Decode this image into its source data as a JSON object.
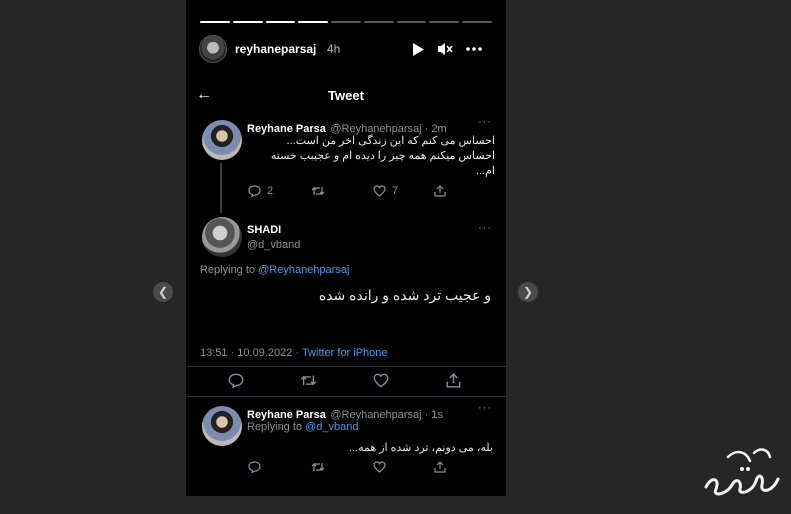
{
  "story": {
    "username": "reyhaneparsaj",
    "time": "4h",
    "progress_segments_total": 9,
    "progress_segments_done": 4
  },
  "tweet_header": {
    "title": "Tweet"
  },
  "tweets": [
    {
      "name": "Reyhane Parsa",
      "handle": "@Reyhanehparsaj · 2m",
      "lines": [
        "احساس می کنم که این زندگی اخر من است...",
        "احساس میکنم همه چیز را دیده ام و عجیبب خسته",
        "ام..."
      ],
      "replies": "2",
      "likes": "7"
    },
    {
      "name": "SHADI",
      "handle": "@d_vband",
      "replying_prefix": "Replying to",
      "replying_to": "@Reyhanehparsaj",
      "text": "و عجیب ترد شده و رانده شده",
      "timestamp": "13:51 · 10.09.2022 ·",
      "source": "Twitter for iPhone"
    },
    {
      "name": "Reyhane Parsa",
      "handle": "@Reyhanehparsaj · 1s",
      "replying_prefix": "Replying to",
      "replying_to": "@d_vband",
      "text": "بله، می دونم، ترد شده از همه..."
    }
  ],
  "icons": {
    "play": "play-icon",
    "mute": "mute-icon",
    "more": "more-icon",
    "back": "back-arrow-icon",
    "reply": "reply-icon",
    "retweet": "retweet-icon",
    "like": "like-icon",
    "share": "share-icon",
    "prev": "prev-story-icon",
    "next": "next-story-icon"
  },
  "colors": {
    "accent": "#4a99e9",
    "background": "#000000",
    "page": "#262626"
  }
}
